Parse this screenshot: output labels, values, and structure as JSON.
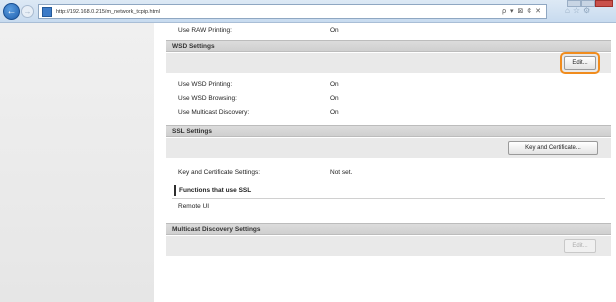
{
  "browser": {
    "url": "http://192.168.0.215/m_network_tcpip.html",
    "address_tools": "ρ ▾ ⊠ ¢ ✕"
  },
  "settings": {
    "raw_printing": {
      "label": "Use RAW Printing:",
      "value": "On"
    },
    "wsd": {
      "title": "WSD Settings",
      "edit_button": "Edit...",
      "rows": [
        {
          "label": "Use WSD Printing:",
          "value": "On"
        },
        {
          "label": "Use WSD Browsing:",
          "value": "On"
        },
        {
          "label": "Use Multicast Discovery:",
          "value": "On"
        }
      ]
    },
    "ssl": {
      "title": "SSL Settings",
      "key_button": "Key and Certificate...",
      "key_row": {
        "label": "Key and Certificate Settings:",
        "value": "Not set."
      },
      "functions_heading": "Functions that use SSL",
      "functions": [
        "Remote UI"
      ]
    },
    "multicast": {
      "title": "Multicast Discovery Settings",
      "edit_button": "Edit..."
    }
  },
  "colors": {
    "highlight": "#f08c1e",
    "section_header": "#d4d4d4"
  }
}
